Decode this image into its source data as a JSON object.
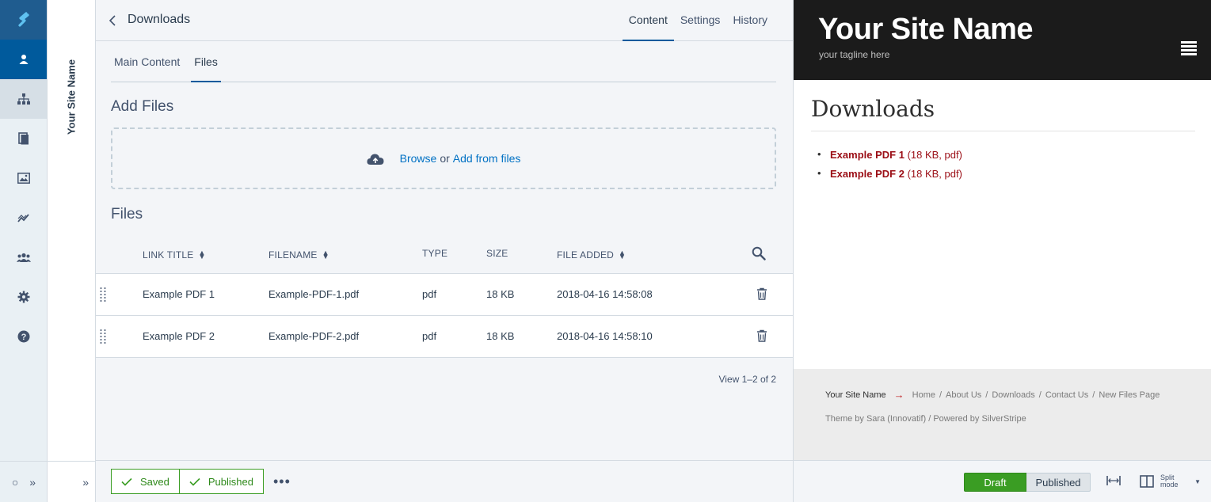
{
  "rail": {
    "items": [
      {
        "name": "pages-icon"
      },
      {
        "name": "site-tree-icon"
      },
      {
        "name": "files-icon"
      },
      {
        "name": "images-icon"
      },
      {
        "name": "reports-icon"
      },
      {
        "name": "security-icon"
      },
      {
        "name": "settings-icon"
      },
      {
        "name": "help-icon"
      }
    ],
    "bottom_left": "○",
    "bottom_right": "»"
  },
  "tree": {
    "site_name": "Your Site Name",
    "collapse": "»"
  },
  "editor": {
    "title": "Downloads",
    "tabs": [
      "Content",
      "Settings",
      "History"
    ],
    "subtabs": [
      "Main Content",
      "Files"
    ],
    "add_files_heading": "Add Files",
    "browse": "Browse",
    "or": "or",
    "add_from_files": "Add from files",
    "files_heading": "Files",
    "columns": {
      "link_title": "LINK TITLE",
      "filename": "FILENAME",
      "type": "TYPE",
      "size": "SIZE",
      "file_added": "FILE ADDED"
    },
    "rows": [
      {
        "title": "Example PDF 1",
        "filename": "Example-PDF-1.pdf",
        "type": "pdf",
        "size": "18 KB",
        "added": "2018-04-16 14:58:08"
      },
      {
        "title": "Example PDF 2",
        "filename": "Example-PDF-2.pdf",
        "type": "pdf",
        "size": "18 KB",
        "added": "2018-04-16 14:58:10"
      }
    ],
    "pager": "View 1–2 of 2",
    "saved": "Saved",
    "published": "Published",
    "more": "•••"
  },
  "preview": {
    "site_name": "Your Site Name",
    "tagline": "your tagline here",
    "page_title": "Downloads",
    "items": [
      {
        "title": "Example PDF 1",
        "meta": "(18 KB, pdf)"
      },
      {
        "title": "Example PDF 2",
        "meta": "(18 KB, pdf)"
      }
    ],
    "breadcrumb_home": "Your Site Name",
    "breadcrumb_arrow": "→",
    "nav": [
      "Home",
      "About Us",
      "Downloads",
      "Contact Us",
      "New Files Page"
    ],
    "credit": "Theme by Sara (Innovatif) / Powered by SilverStripe",
    "mode_draft": "Draft",
    "mode_published": "Published",
    "split_line1": "Split",
    "split_line2": "mode",
    "caret": "▼"
  },
  "colors": {
    "brand": "#005a9c",
    "success": "#3a9d23",
    "link": "#0071c4",
    "preview_link": "#9b0e16"
  }
}
